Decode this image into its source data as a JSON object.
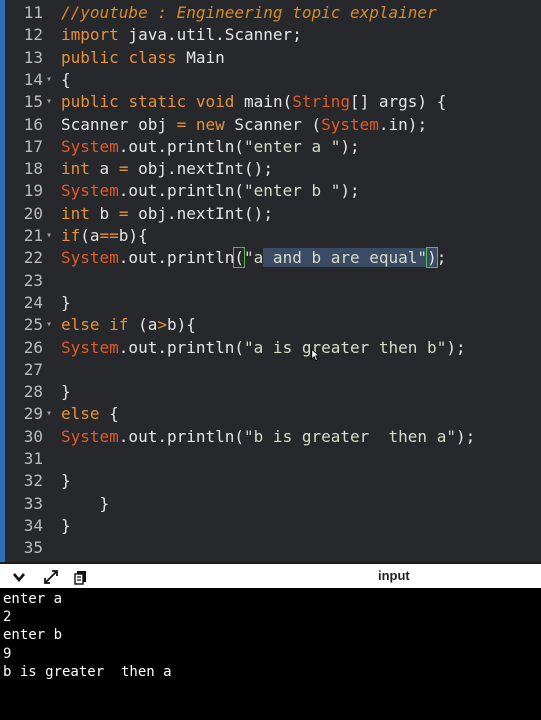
{
  "editor": {
    "lines": [
      {
        "n": "11",
        "fold": false,
        "segs": [
          {
            "t": "//youtube : Engineering topic explainer",
            "c": "cm"
          }
        ]
      },
      {
        "n": "12",
        "fold": false,
        "segs": [
          {
            "t": "import",
            "c": "kw"
          },
          {
            "t": " java.util.Scanner;",
            "c": ""
          }
        ]
      },
      {
        "n": "13",
        "fold": false,
        "segs": [
          {
            "t": "public",
            "c": "kw"
          },
          {
            "t": " ",
            "c": ""
          },
          {
            "t": "class",
            "c": "kw"
          },
          {
            "t": " Main",
            "c": ""
          }
        ]
      },
      {
        "n": "14",
        "fold": true,
        "segs": [
          {
            "t": "{",
            "c": ""
          }
        ]
      },
      {
        "n": "15",
        "fold": true,
        "segs": [
          {
            "t": "public",
            "c": "kw"
          },
          {
            "t": " ",
            "c": ""
          },
          {
            "t": "static",
            "c": "kw"
          },
          {
            "t": " ",
            "c": ""
          },
          {
            "t": "void",
            "c": "kw"
          },
          {
            "t": " main(",
            "c": ""
          },
          {
            "t": "String",
            "c": "ty"
          },
          {
            "t": "[] args) {",
            "c": ""
          }
        ]
      },
      {
        "n": "16",
        "fold": false,
        "segs": [
          {
            "t": "Scanner obj ",
            "c": ""
          },
          {
            "t": "=",
            "c": "kw"
          },
          {
            "t": " ",
            "c": ""
          },
          {
            "t": "new",
            "c": "kw"
          },
          {
            "t": " Scanner (",
            "c": ""
          },
          {
            "t": "System",
            "c": "ty"
          },
          {
            "t": ".in);",
            "c": ""
          }
        ]
      },
      {
        "n": "17",
        "fold": false,
        "segs": [
          {
            "t": "System",
            "c": "ty"
          },
          {
            "t": ".out.println(",
            "c": ""
          },
          {
            "t": "\"enter a \"",
            "c": "str"
          },
          {
            "t": ");",
            "c": ""
          }
        ]
      },
      {
        "n": "18",
        "fold": false,
        "segs": [
          {
            "t": "int",
            "c": "kw"
          },
          {
            "t": " a ",
            "c": ""
          },
          {
            "t": "=",
            "c": "kw"
          },
          {
            "t": " obj.nextInt();",
            "c": ""
          }
        ]
      },
      {
        "n": "19",
        "fold": false,
        "segs": [
          {
            "t": "System",
            "c": "ty"
          },
          {
            "t": ".out.println(",
            "c": ""
          },
          {
            "t": "\"enter b \"",
            "c": "str"
          },
          {
            "t": ");",
            "c": ""
          }
        ]
      },
      {
        "n": "20",
        "fold": false,
        "segs": [
          {
            "t": "int",
            "c": "kw"
          },
          {
            "t": " b ",
            "c": ""
          },
          {
            "t": "=",
            "c": "kw"
          },
          {
            "t": " obj.nextInt();",
            "c": ""
          }
        ]
      },
      {
        "n": "21",
        "fold": true,
        "segs": [
          {
            "t": "if",
            "c": "kw"
          },
          {
            "t": "(a",
            "c": ""
          },
          {
            "t": "==",
            "c": "kw"
          },
          {
            "t": "b){",
            "c": ""
          }
        ]
      },
      {
        "n": "22",
        "fold": false,
        "segs": [
          {
            "t": "System",
            "c": "ty"
          },
          {
            "t": ".out.println",
            "c": ""
          },
          {
            "t": "(",
            "c": "brk"
          },
          {
            "t": "\"a",
            "c": "str"
          },
          {
            "t": " and b are equal\"",
            "c": "str sel"
          },
          {
            "t": ")",
            "c": "brk sel"
          },
          {
            "t": ";",
            "c": ""
          }
        ]
      },
      {
        "n": "23",
        "fold": false,
        "segs": []
      },
      {
        "n": "24",
        "fold": false,
        "segs": [
          {
            "t": "}",
            "c": ""
          }
        ]
      },
      {
        "n": "25",
        "fold": true,
        "segs": [
          {
            "t": "else",
            "c": "kw"
          },
          {
            "t": " ",
            "c": ""
          },
          {
            "t": "if",
            "c": "kw"
          },
          {
            "t": " (a",
            "c": ""
          },
          {
            "t": ">",
            "c": "kw"
          },
          {
            "t": "b){",
            "c": ""
          }
        ]
      },
      {
        "n": "26",
        "fold": false,
        "segs": [
          {
            "t": "System",
            "c": "ty"
          },
          {
            "t": ".out.println(",
            "c": ""
          },
          {
            "t": "\"a is greater then b\"",
            "c": "str"
          },
          {
            "t": ");",
            "c": ""
          }
        ]
      },
      {
        "n": "27",
        "fold": false,
        "segs": []
      },
      {
        "n": "28",
        "fold": false,
        "segs": [
          {
            "t": "}",
            "c": ""
          }
        ]
      },
      {
        "n": "29",
        "fold": true,
        "segs": [
          {
            "t": "else",
            "c": "kw"
          },
          {
            "t": " {",
            "c": ""
          }
        ]
      },
      {
        "n": "30",
        "fold": false,
        "segs": [
          {
            "t": "System",
            "c": "ty"
          },
          {
            "t": ".out.println(",
            "c": ""
          },
          {
            "t": "\"b is greater  then a\"",
            "c": "str"
          },
          {
            "t": ");",
            "c": ""
          }
        ]
      },
      {
        "n": "31",
        "fold": false,
        "segs": []
      },
      {
        "n": "32",
        "fold": false,
        "segs": [
          {
            "t": "}",
            "c": ""
          }
        ]
      },
      {
        "n": "33",
        "fold": false,
        "segs": [
          {
            "t": "    }",
            "c": ""
          }
        ]
      },
      {
        "n": "34",
        "fold": false,
        "segs": [
          {
            "t": "}",
            "c": ""
          }
        ]
      },
      {
        "n": "35",
        "fold": false,
        "segs": []
      }
    ]
  },
  "toolbar": {
    "title": "input",
    "icons": [
      "chevron-down-icon",
      "expand-icon",
      "copy-icon"
    ]
  },
  "console": {
    "lines": [
      "enter a",
      "2",
      "enter b",
      "9",
      "b is greater  then a"
    ]
  },
  "colors": {
    "editor_bg": "#26282b",
    "keyword": "#e8903a",
    "type": "#e35a2a",
    "comment": "#d98a2a",
    "selection": "#3b4b63"
  }
}
